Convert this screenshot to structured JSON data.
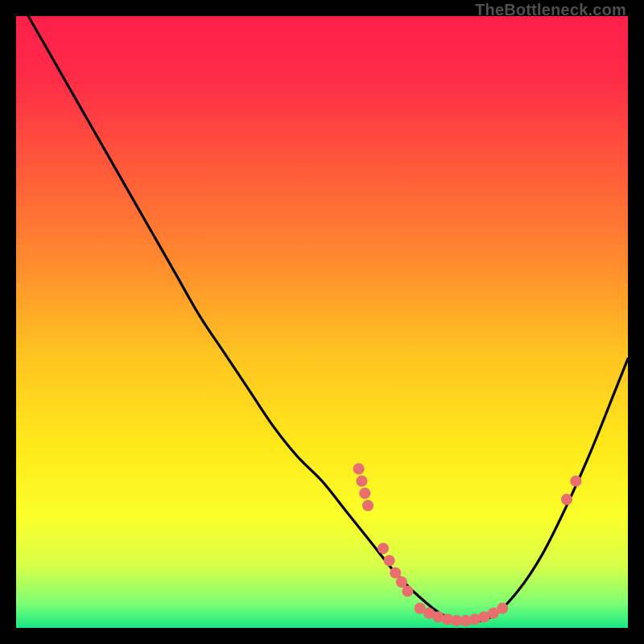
{
  "watermark": "TheBottleneck.com",
  "chart_data": {
    "type": "line",
    "title": "",
    "xlabel": "",
    "ylabel": "",
    "xlim": [
      0,
      100
    ],
    "ylim": [
      0,
      100
    ],
    "grid": false,
    "legend": false,
    "background_gradient": {
      "stops": [
        {
          "offset": 0.0,
          "color": "#ff1f4b"
        },
        {
          "offset": 0.1,
          "color": "#ff2b47"
        },
        {
          "offset": 0.25,
          "color": "#ff5a3a"
        },
        {
          "offset": 0.4,
          "color": "#ff8a2e"
        },
        {
          "offset": 0.55,
          "color": "#ffc321"
        },
        {
          "offset": 0.7,
          "color": "#ffe81a"
        },
        {
          "offset": 0.82,
          "color": "#fbff2a"
        },
        {
          "offset": 0.9,
          "color": "#d6ff4a"
        },
        {
          "offset": 0.96,
          "color": "#7dff74"
        },
        {
          "offset": 1.0,
          "color": "#17e884"
        }
      ]
    },
    "series": [
      {
        "name": "bottleneck-curve",
        "color": "#000000",
        "x": [
          2,
          6,
          10,
          14,
          18,
          22,
          26,
          30,
          34,
          38,
          42,
          46,
          50,
          54,
          58,
          62,
          66,
          70,
          74,
          78,
          82,
          86,
          90,
          94,
          98,
          100
        ],
        "y": [
          100,
          93,
          86,
          79,
          72,
          65,
          58,
          51,
          45,
          39,
          33,
          28,
          24,
          19,
          14,
          9,
          5,
          2,
          1,
          2,
          6,
          12,
          20,
          29,
          39,
          44
        ]
      }
    ],
    "marker_clusters": [
      {
        "name": "cluster-left-ascending",
        "color": "#e96f6f",
        "points": [
          {
            "x": 56,
            "y": 26
          },
          {
            "x": 56.5,
            "y": 24
          },
          {
            "x": 57,
            "y": 22
          },
          {
            "x": 57.5,
            "y": 20
          }
        ]
      },
      {
        "name": "cluster-valley-left",
        "color": "#e96f6f",
        "points": [
          {
            "x": 60,
            "y": 13
          },
          {
            "x": 61,
            "y": 11
          },
          {
            "x": 62,
            "y": 9
          },
          {
            "x": 63,
            "y": 7.5
          },
          {
            "x": 64,
            "y": 6
          }
        ]
      },
      {
        "name": "cluster-valley-bottom",
        "color": "#e96f6f",
        "points": [
          {
            "x": 66,
            "y": 3.2
          },
          {
            "x": 67.5,
            "y": 2.4
          },
          {
            "x": 69,
            "y": 1.8
          },
          {
            "x": 70.5,
            "y": 1.4
          },
          {
            "x": 72,
            "y": 1.2
          },
          {
            "x": 73.5,
            "y": 1.2
          },
          {
            "x": 75,
            "y": 1.4
          },
          {
            "x": 76.5,
            "y": 1.8
          },
          {
            "x": 78,
            "y": 2.4
          },
          {
            "x": 79.5,
            "y": 3.2
          }
        ]
      },
      {
        "name": "cluster-right-ascending",
        "color": "#e96f6f",
        "points": [
          {
            "x": 90,
            "y": 21
          },
          {
            "x": 91.5,
            "y": 24
          }
        ]
      }
    ]
  }
}
